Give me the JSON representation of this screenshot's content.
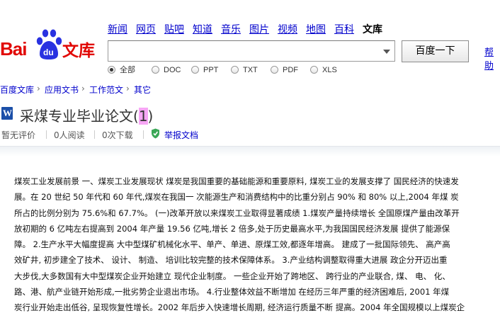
{
  "logo": {
    "bai": "Bai",
    "du": "du",
    "wenku": "文库"
  },
  "nav": {
    "items": [
      "新闻",
      "网页",
      "贴吧",
      "知道",
      "音乐",
      "图片",
      "视频",
      "地图",
      "百科"
    ],
    "current": "文库"
  },
  "search": {
    "value": "",
    "button_label": "百度一下",
    "help_label": "帮助"
  },
  "filters": [
    {
      "label": "全部",
      "checked": true
    },
    {
      "label": "DOC",
      "checked": false
    },
    {
      "label": "PPT",
      "checked": false
    },
    {
      "label": "TXT",
      "checked": false
    },
    {
      "label": "PDF",
      "checked": false
    },
    {
      "label": "XLS",
      "checked": false
    }
  ],
  "breadcrumb": {
    "items": [
      "百度文库",
      "应用文书",
      "工作范文",
      "其它"
    ],
    "separator": "›"
  },
  "document": {
    "icon_letter": "W",
    "title_main": "采煤专业毕业论文(",
    "title_highlight": "1",
    "title_end": ")",
    "rating": "暂无评价",
    "reads": "0人阅读",
    "downloads": "0次下载",
    "report_label": "举报文档",
    "lines": [
      "煤炭工业发展前景 一、煤炭工业发展现状 煤炭是我国重要的基础能源和重要原料, 煤炭工业的发展支撑了 国民经济的快速发",
      "展。在 20 世纪 50 年代和 60 年代,煤炭在我国一 次能源生产和消费结构中的比重分别占 90% 和 80% 以上,2004 年煤 炭",
      "所占的比例分别为 75.6%和 67.7%。 (一)改革开放以来煤炭工业取得显著成绩 1.煤炭产量持续增长 全国原煤产量由改革开",
      "放初期的 6 亿吨左右提高到 2004 年产量 19.56 亿吨,增长 2 倍多,处于历史最高水平,为我国国民经济发展 提供了能源保",
      "障。 2.生产水平大幅度提高 大中型煤矿机械化水平、单产、单进、原煤工效,都逐年增高。 建成了一批国际领先、 高产高",
      "效矿井, 初步建全了技术、 设计、 制造、 培训比较完整的技术保障体系。 3.产业结构调整取得重大进展 政企分开迈出重",
      "大步伐,大多数国有大中型煤炭企业开始建立 现代企业制度。 一些企业开始了跨地区、 跨行业的产业联合, 煤、 电、 化、",
      "路、港、航产业链开始形成,一批劣势企业退出市场。 4.行业整体效益不断增加 在经历三年严重的经济困难后, 2001 年煤",
      "炭行业开始走出低谷, 呈现恢复性增长。2002 年后步入快速增长周期, 经济运行质量不断 提高。2004 年全国规模以上煤炭企"
    ]
  }
}
